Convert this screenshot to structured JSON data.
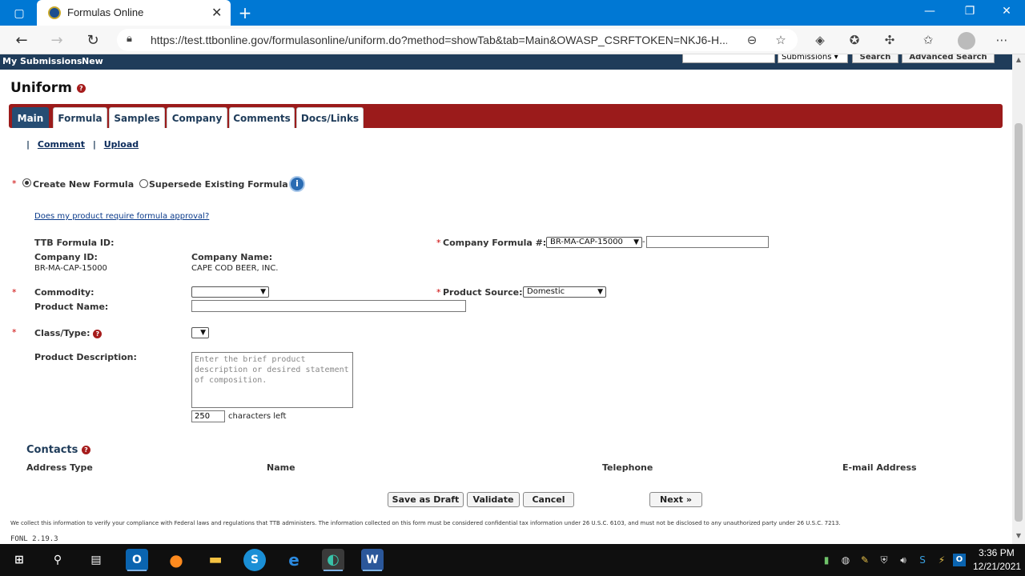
{
  "browser": {
    "tab_title": "Formulas Online",
    "url": "https://test.ttbonline.gov/formulasonline/uniform.do?method=showTab&tab=Main&OWASP_CSRFTOKEN=NKJ6-H..."
  },
  "site_nav": {
    "my_submissions": "My Submissions",
    "new": "New",
    "search_scope": "Submissions",
    "search_button": "Search",
    "advanced_search": "Advanced Search"
  },
  "page": {
    "title": "Uniform",
    "tabs": [
      {
        "label": "Main",
        "active": true
      },
      {
        "label": "Formula"
      },
      {
        "label": "Samples"
      },
      {
        "label": "Company"
      },
      {
        "label": "Comments"
      },
      {
        "label": "Docs/Links"
      }
    ],
    "toolbar": {
      "separator": "|",
      "comment": "Comment",
      "upload": "Upload"
    }
  },
  "form": {
    "radio_new": "Create New Formula",
    "radio_supersede": "Supersede Existing Formula",
    "approval_link": "Does my product require formula approval?",
    "ttb_formula_id_label": "TTB Formula ID:",
    "company_id_label": "Company ID:",
    "company_id_value": "BR-MA-CAP-15000",
    "company_name_label": "Company Name:",
    "company_name_value": "CAPE COD BEER, INC.",
    "company_formula_label": "Company Formula #:",
    "company_formula_select": "BR-MA-CAP-15000",
    "company_formula_dash": "-",
    "commodity_label": "Commodity:",
    "product_source_label": "Product Source:",
    "product_source_value": "Domestic",
    "product_name_label": "Product Name:",
    "class_type_label": "Class/Type:",
    "product_description_label": "Product Description:",
    "product_description_placeholder": "Enter the brief product description or desired statement of composition.",
    "chars_left_value": "250",
    "chars_left_label": "characters left",
    "required_mark": "*"
  },
  "contacts": {
    "heading": "Contacts",
    "columns": [
      "Address Type",
      "Name",
      "Telephone",
      "E-mail Address"
    ]
  },
  "actions": {
    "save_draft": "Save as Draft",
    "validate": "Validate",
    "cancel": "Cancel",
    "next": "Next »"
  },
  "footer": {
    "disclaimer": "We collect this information to verify your compliance with Federal laws and regulations that TTB administers. The information collected on this form must be considered confidential tax information under 26 U.S.C. 6103, and must not be disclosed to any unauthorized party under 26 U.S.C. 7213.",
    "version": "FONL 2.19.3"
  },
  "taskbar": {
    "time": "3:36 PM",
    "date": "12/21/2021"
  },
  "colors": {
    "browser_accent": "#0078d4",
    "site_nav": "#1f3c5a",
    "tab_strip": "#9b1b1b",
    "active_tab": "#264d73"
  }
}
